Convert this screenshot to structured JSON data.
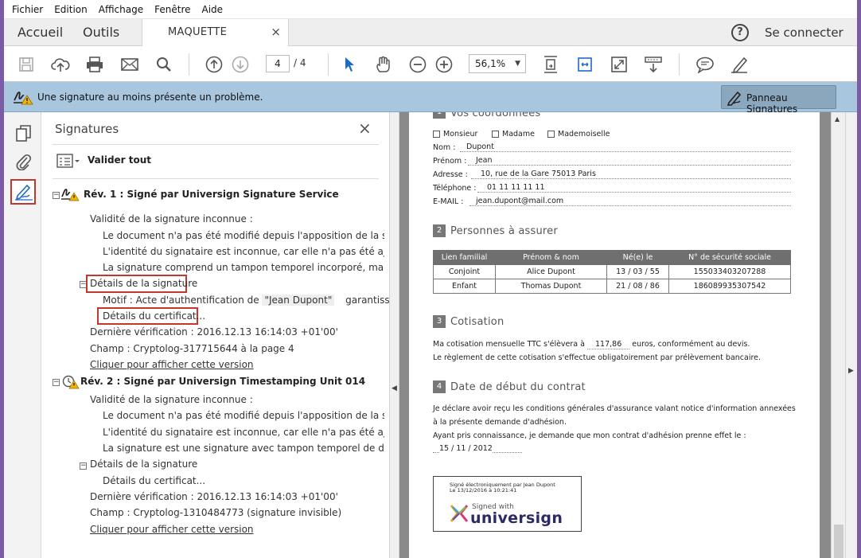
{
  "menu": [
    "Fichier",
    "Edition",
    "Affichage",
    "Fenêtre",
    "Aide"
  ],
  "tabs": {
    "home": "Accueil",
    "tools": "Outils",
    "document": "MAQUETTE",
    "close": "×"
  },
  "header": {
    "help": "?",
    "connect": "Se connecter"
  },
  "toolbar": {
    "page_current": "4",
    "page_total": "/ 4",
    "zoom": "56,1%"
  },
  "sigbar": {
    "message": "Une signature au moins présente un problème.",
    "panel_button": "Panneau Signatures"
  },
  "panel": {
    "title": "Signatures",
    "close": "×",
    "validate_all": "Valider tout",
    "rev1": {
      "title": "Rév. 1 : Signé par Universign Signature Service",
      "validity": "Validité de la signature inconnue :",
      "line1": "Le document n'a pas été modifié depuis l'apposition de la signatur",
      "line2": "L'identité du signataire est inconnue, car elle n'a pas été ajoutée à l",
      "line3": "La signature comprend un tampon temporel incorporé, mais il n'a",
      "details": "Détails de la signature",
      "motif": "Motif : Acte d'authentification de",
      "motif_name": "\"Jean Dupont\"",
      "motif_tail": "garantissant soi",
      "cert": "Détails du certificat...",
      "last_check": "Dernière vérification : 2016.12.13 16:14:03 +01'00'",
      "field": "Champ : Cryptolog-317715644 à la page 4",
      "view": "Cliquer pour afficher cette version"
    },
    "rev2": {
      "title": "Rév. 2 : Signé par Universign Timestamping Unit 014",
      "validity": "Validité de la signature inconnue :",
      "line1": "Le document n'a pas été modifié depuis l'apposition de la signatur",
      "line2": "L'identité du signataire est inconnue, car elle n'a pas été ajoutée à l",
      "line3": "La signature est une signature avec tampon temporel de documen",
      "details": "Détails de la signature",
      "cert": "Détails du certificat...",
      "last_check": "Dernière vérification : 2016.12.13 16:14:03 +01'00'",
      "field": "Champ : Cryptolog-1310484773 (signature invisible)",
      "view": "Cliquer pour afficher cette version"
    }
  },
  "doc": {
    "sec1": {
      "num": "1",
      "title": "Vos coordonnées"
    },
    "civility": [
      "Monsieur",
      "Madame",
      "Mademoiselle"
    ],
    "fields": [
      {
        "label": "Nom :",
        "value": "Dupont"
      },
      {
        "label": "Prénom :",
        "value": "Jean"
      },
      {
        "label": "Adresse :",
        "value": "10, rue de la Gare 75013 Paris"
      },
      {
        "label": "Téléphone :",
        "value": "01 11 11 11 11"
      },
      {
        "label": "E-MAIL :",
        "value": "jean.dupont@mail.com"
      }
    ],
    "sec2": {
      "num": "2",
      "title": "Personnes à assurer"
    },
    "table": {
      "headers": [
        "Lien familial",
        "Prénom & nom",
        "Né(e) le",
        "N° de sécurité sociale"
      ],
      "rows": [
        [
          "Conjoint",
          "Alice Dupont",
          "13 / 03 / 55",
          "155033403207288"
        ],
        [
          "Enfant",
          "Thomas Dupont",
          "21 / 08 / 86",
          "186089935307542"
        ]
      ]
    },
    "sec3": {
      "num": "3",
      "title": "Cotisation"
    },
    "cotisation_pre": "Ma cotisation mensuelle TTC s'élèvera à",
    "cotisation_value": "117,86",
    "cotisation_post": "euros, conformément au devis.",
    "cotisation_line2": "Le règlement de cette cotisation s'effectue obligatoirement par prélèvement bancaire.",
    "sec4": {
      "num": "4",
      "title": "Date de début du contrat"
    },
    "contract_l1": "Je déclare avoir reçu les conditions générales d'assurance valant notice d'information annexées",
    "contract_l2": "à la présente demande d'adhésion.",
    "contract_l3": "Ayant pris connaissance, je demande que mon contrat d'adhésion prenne effet le :",
    "contract_date": "15 / 11 / 2012",
    "stamp": {
      "line1": "Signé électroniquement par Jean Dupont",
      "line2": "Le 13/12/2016 à 10:21:41",
      "signed_with": "Signed with",
      "brand": "universign"
    }
  },
  "colors": {
    "accent": "#c0392b",
    "sigbar": "#a8c6de",
    "frame": "#7c5aa6"
  }
}
